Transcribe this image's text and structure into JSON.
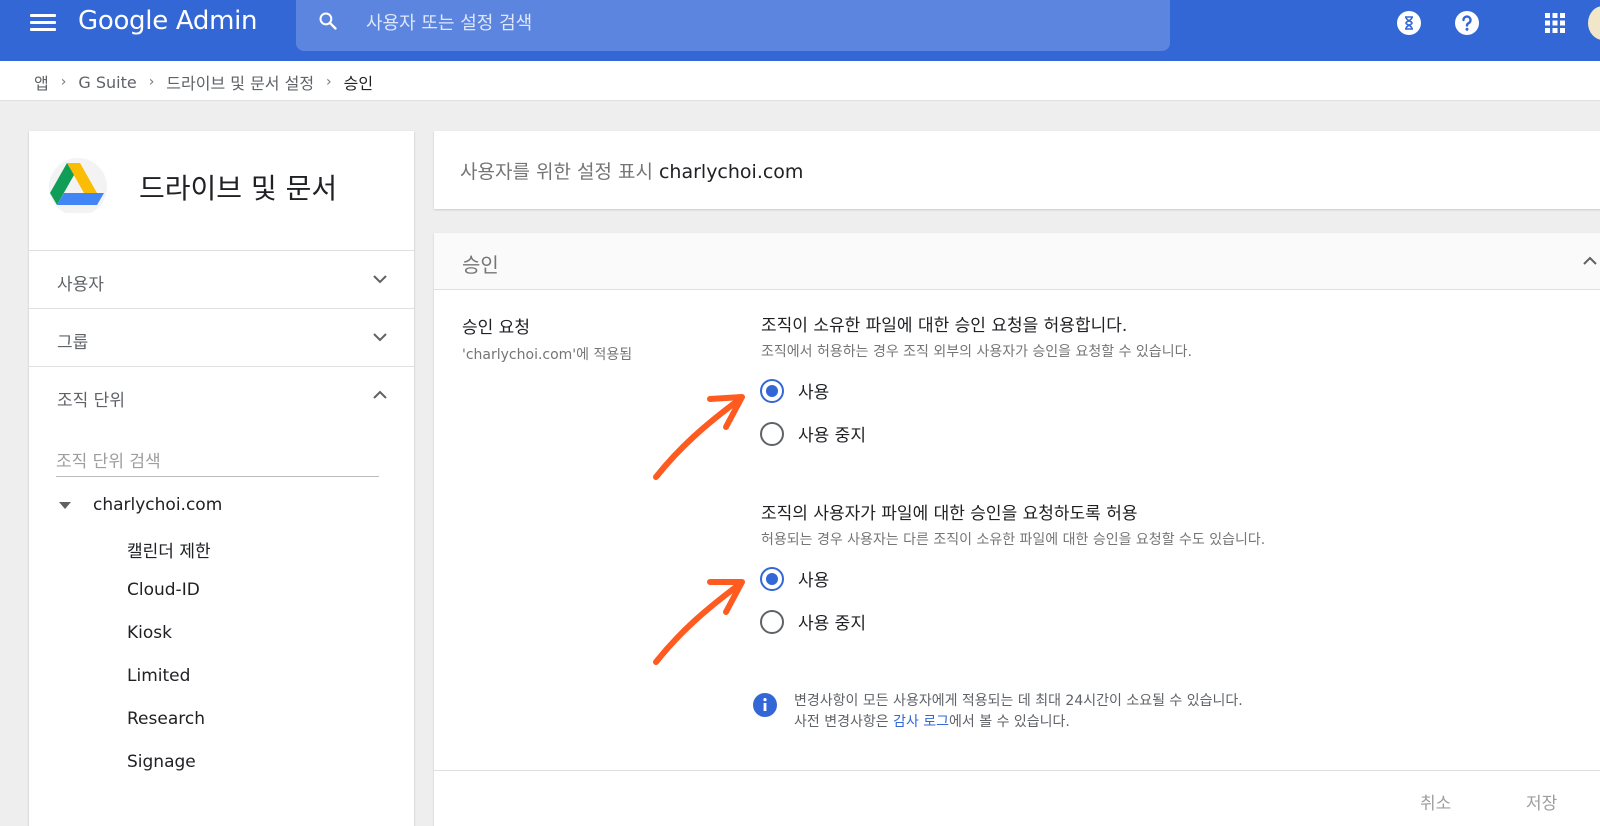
{
  "topbar": {
    "brand": "Google Admin",
    "search_placeholder": "사용자 또는 설정 검색",
    "icons": [
      "menu-icon",
      "search-icon",
      "hourglass-icon",
      "help-icon",
      "apps-grid-icon"
    ]
  },
  "breadcrumb": {
    "items": [
      "앱",
      "G Suite",
      "드라이브 및 문서 설정",
      "승인"
    ]
  },
  "sidebar": {
    "app_title": "드라이브 및 문서",
    "nav": [
      {
        "label": "사용자"
      },
      {
        "label": "그룹"
      },
      {
        "label": "조직 단위"
      }
    ],
    "ou_search_placeholder": "조직 단위 검색",
    "tree": {
      "root": "charlychoi.com",
      "children": [
        "캘린더 제한",
        "Cloud-ID",
        "Kiosk",
        "Limited",
        "Research",
        "Signage"
      ]
    }
  },
  "org_panel": {
    "prefix": "사용자를 위한 설정 표시",
    "domain": "charlychoi.com"
  },
  "main_panel": {
    "title": "승인",
    "setting": {
      "label": "승인 요청",
      "applied": "'charlychoi.com'에 적용됨"
    },
    "options": [
      {
        "title": "조직이 소유한 파일에 대한 승인 요청을 허용합니다.",
        "desc": "조직에서 허용하는 경우 조직 외부의 사용자가 승인을 요청할 수 있습니다.",
        "on_label": "사용",
        "off_label": "사용 중지",
        "selected": "on"
      },
      {
        "title": "조직의 사용자가 파일에 대한 승인을 요청하도록 허용",
        "desc": "허용되는 경우 사용자는 다른 조직이 소유한 파일에 대한 승인을 요청할 수도 있습니다.",
        "on_label": "사용",
        "off_label": "사용 중지",
        "selected": "on"
      }
    ],
    "notice": {
      "line1": "변경사항이 모든 사용자에게 적용되는 데 최대 24시간이 소요될 수 있습니다.",
      "line2_prefix": "사전 변경사항은 ",
      "line2_link": "감사 로그",
      "line2_suffix": "에서 볼 수 있습니다."
    },
    "buttons": {
      "cancel": "취소",
      "save": "저장"
    }
  },
  "colors": {
    "topbar": "#3367d6",
    "accent": "#3367d6",
    "annotation_arrow": "#ff5a1f"
  }
}
